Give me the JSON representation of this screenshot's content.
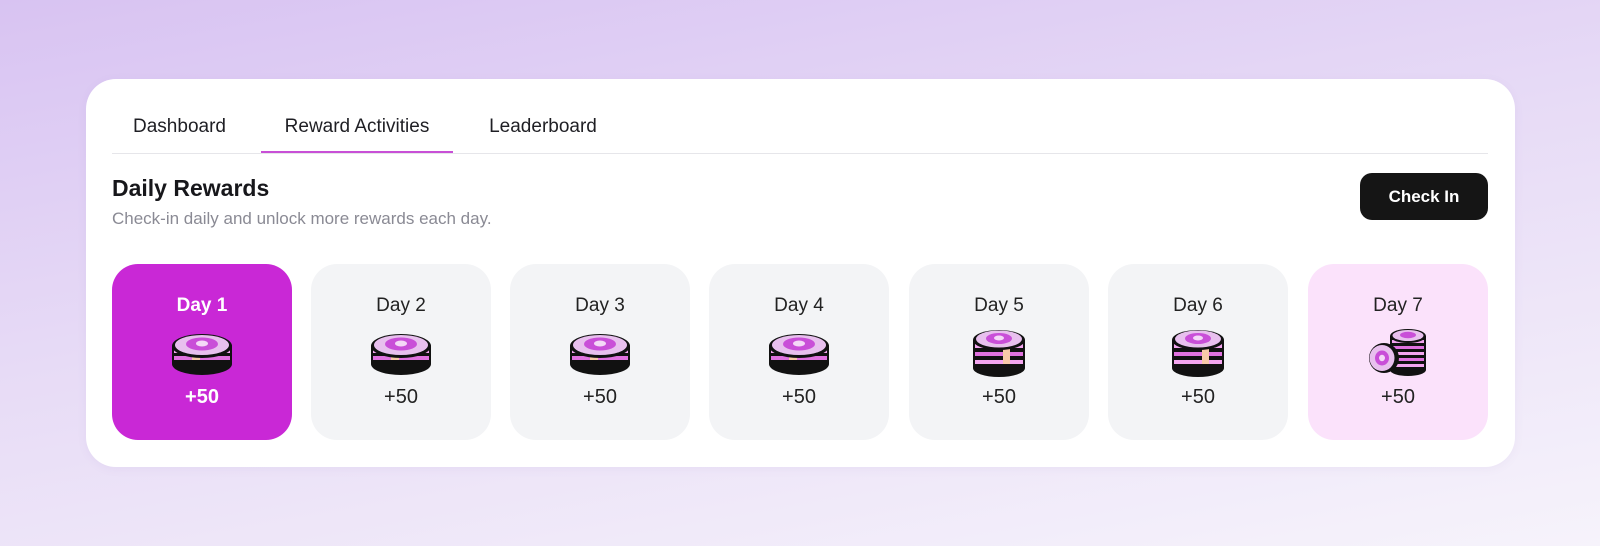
{
  "tabs": [
    {
      "label": "Dashboard",
      "active": false
    },
    {
      "label": "Reward Activities",
      "active": true
    },
    {
      "label": "Leaderboard",
      "active": false
    }
  ],
  "rewards": {
    "title": "Daily Rewards",
    "subtitle": "Check-in daily and unlock more rewards each day.",
    "check_in_label": "Check In"
  },
  "days": [
    {
      "label": "Day 1",
      "value": "+50",
      "state": "current",
      "icon": "coin-stack-icon"
    },
    {
      "label": "Day 2",
      "value": "+50",
      "state": "upcoming",
      "icon": "coin-stack-icon"
    },
    {
      "label": "Day 3",
      "value": "+50",
      "state": "upcoming",
      "icon": "coin-stack-icon"
    },
    {
      "label": "Day 4",
      "value": "+50",
      "state": "upcoming",
      "icon": "coin-stack-icon"
    },
    {
      "label": "Day 5",
      "value": "+50",
      "state": "upcoming",
      "icon": "coin-stack-tall-icon"
    },
    {
      "label": "Day 6",
      "value": "+50",
      "state": "upcoming",
      "icon": "coin-stack-tall-icon"
    },
    {
      "label": "Day 7",
      "value": "+50",
      "state": "bonus",
      "icon": "coin-pile-icon"
    }
  ],
  "colors": {
    "accent": "#c928d6",
    "tab_underline": "#c84fd6",
    "day_card": "#f3f4f6",
    "bonus_card": "#fbe2fb",
    "button": "#151515"
  }
}
